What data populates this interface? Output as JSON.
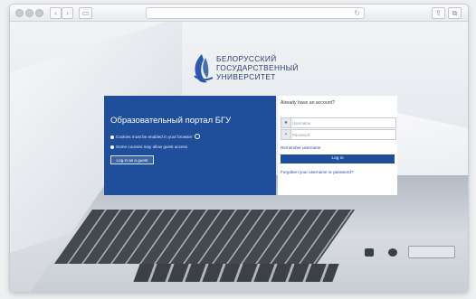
{
  "browser": {
    "nav_back_icon": "chevron-left-icon",
    "nav_forward_icon": "chevron-right-icon",
    "sidebar_icon": "sidebar-icon",
    "reload_icon": "reload-icon",
    "share_icon": "share-icon",
    "tabs_icon": "tabs-icon"
  },
  "logo": {
    "line1": "БЕЛОРУССКИЙ",
    "line2": "ГОСУДАРСТВЕННЫЙ",
    "line3": "УНИВЕРСИТЕТ",
    "color": "#2a3f6e"
  },
  "login": {
    "title": "Образовательный портал БГУ",
    "notice_cookies": "Cookies must be enabled in your browser",
    "notice_guest": "Some courses may allow guest access",
    "guest_button": "Log in as a guest",
    "already_account": "Already have an account?",
    "username_placeholder": "Username",
    "password_placeholder": "Password",
    "remember": "Remember username",
    "login_button": "Log in",
    "forgot": "Forgotten your username or password?",
    "panel_color": "#1f4e9a"
  }
}
